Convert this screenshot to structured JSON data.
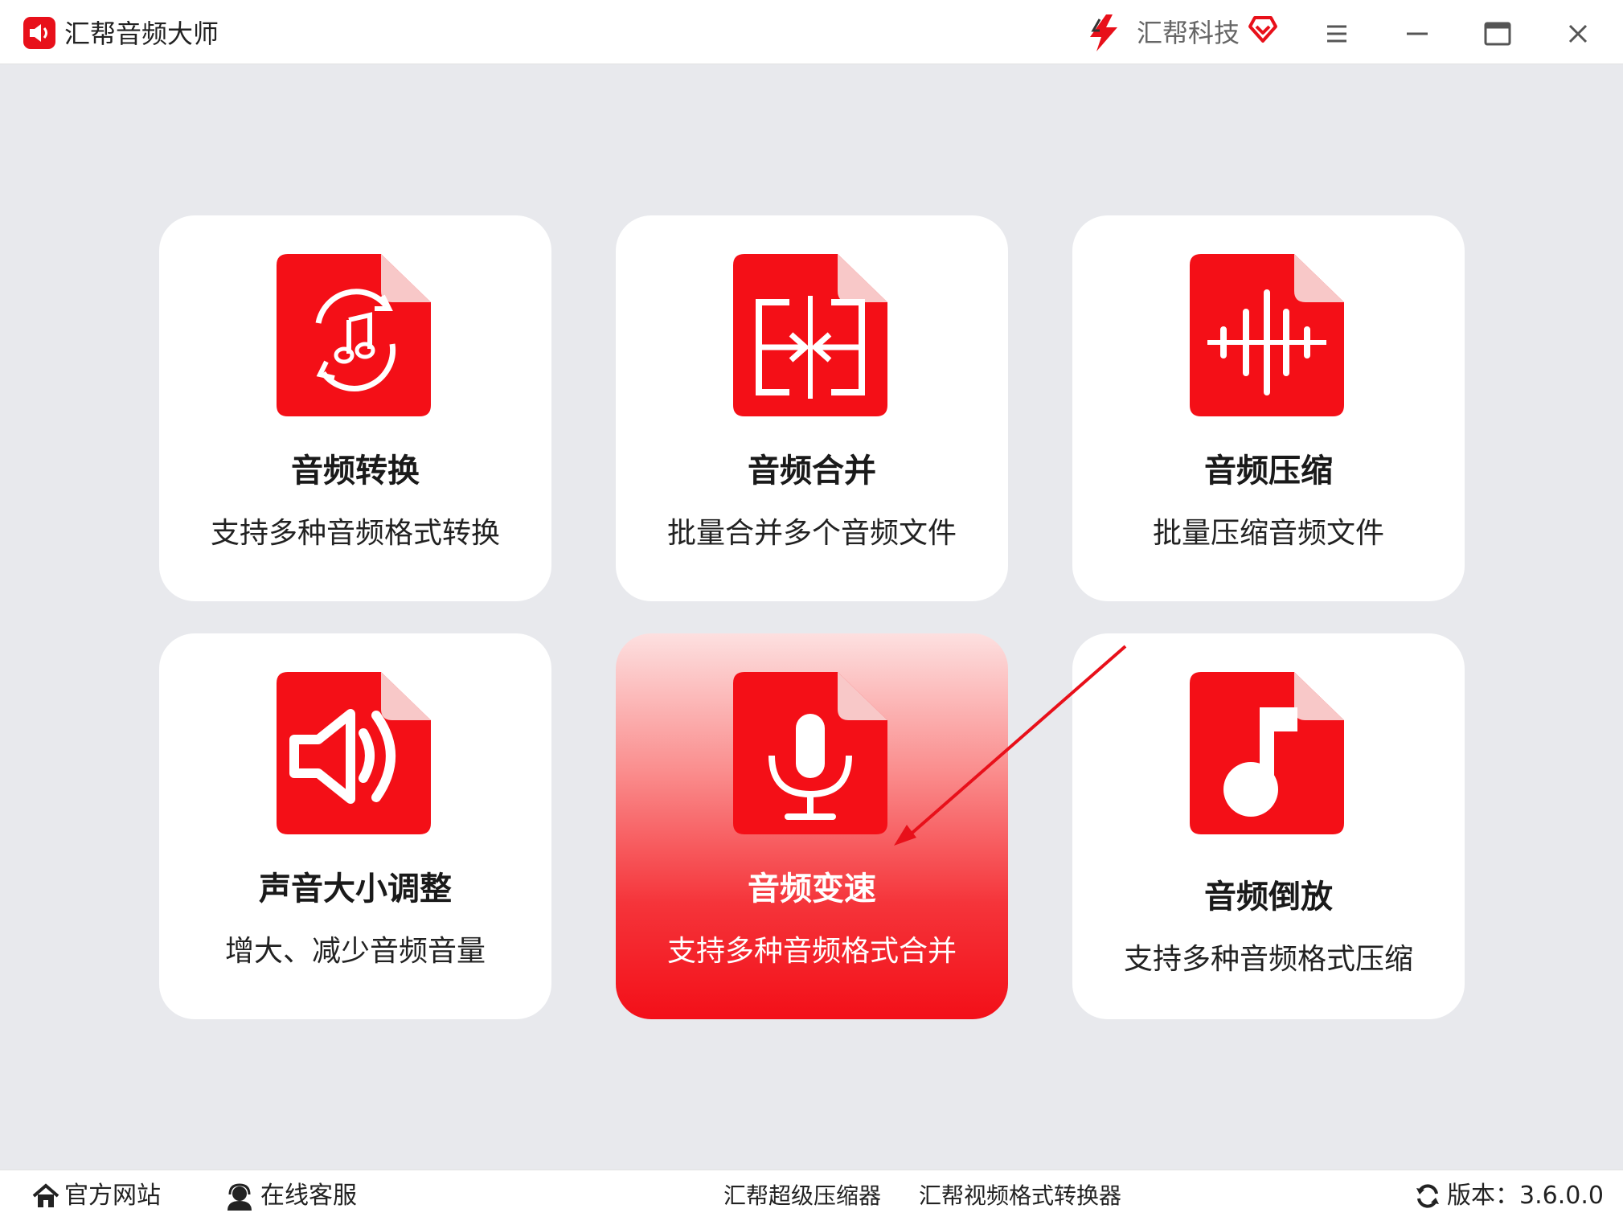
{
  "titlebar": {
    "app_title": "汇帮音频大师",
    "brand_name": "汇帮科技",
    "icons": [
      "app-speaker-icon",
      "brand-lightning-icon",
      "vip-diamond-icon",
      "menu-icon",
      "minimize-icon",
      "maximize-icon",
      "close-icon"
    ]
  },
  "cards": [
    {
      "title": "音频转换",
      "desc": "支持多种音频格式转换",
      "icon": "music-convert-icon"
    },
    {
      "title": "音频合并",
      "desc": "批量合并多个音频文件",
      "icon": "merge-icon"
    },
    {
      "title": "音频压缩",
      "desc": "批量压缩音频文件",
      "icon": "waveform-compress-icon"
    },
    {
      "title": "声音大小调整",
      "desc": "增大、减少音频音量",
      "icon": "volume-icon"
    },
    {
      "title": "音频变速",
      "desc": "支持多种音频格式合并",
      "icon": "microphone-icon",
      "active": true
    },
    {
      "title": "音频倒放",
      "desc": "支持多种音频格式压缩",
      "icon": "music-note-icon"
    }
  ],
  "footer": {
    "website": "官方网站",
    "service": "在线客服",
    "link_compressor": "汇帮超级压缩器",
    "link_video_converter": "汇帮视频格式转换器",
    "version": "版本：3.6.0.0"
  },
  "colors": {
    "accent": "#f30f18",
    "icon_red": "#f40f17",
    "background": "#e8e9ed"
  }
}
